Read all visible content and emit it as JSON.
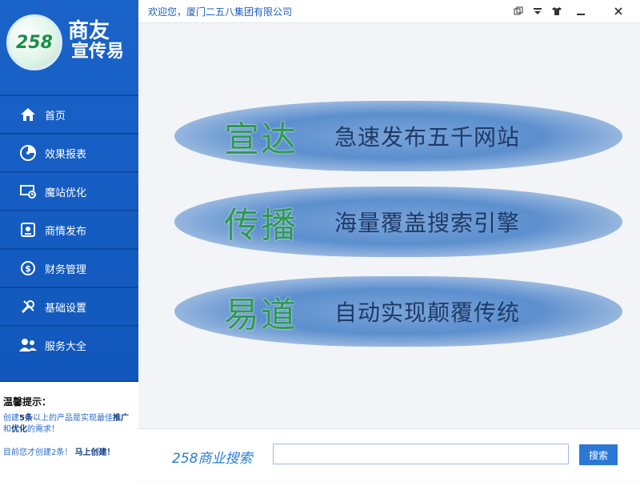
{
  "logo": {
    "number": "258",
    "title": "商友",
    "subtitle": "宣传易"
  },
  "titlebar": {
    "welcome": "欢迎您，厦门二五八集团有限公司",
    "buttons": [
      "restore-icon",
      "dropdown-icon",
      "skin-icon",
      "minimize-icon",
      "close-icon"
    ]
  },
  "sidebar": {
    "items": [
      {
        "label": "首页",
        "icon": "home-icon"
      },
      {
        "label": "效果报表",
        "icon": "report-icon"
      },
      {
        "label": "魔站优化",
        "icon": "optimize-icon"
      },
      {
        "label": "商情发布",
        "icon": "publish-icon"
      },
      {
        "label": "财务管理",
        "icon": "finance-icon"
      },
      {
        "label": "基础设置",
        "icon": "settings-icon"
      },
      {
        "label": "服务大全",
        "icon": "services-icon"
      }
    ]
  },
  "tips": {
    "title": "温馨提示：",
    "body_part1": "创建",
    "body_count": "5条",
    "body_part2": "以上的产品是实现最佳",
    "body_kw1": "推广",
    "body_and": "和",
    "body_kw2": "优化",
    "body_part3": "的需求！",
    "line2_text": "目前您才创建2条！",
    "line2_cta": "马上创建！"
  },
  "banners": [
    {
      "big": "宣达",
      "small": "急速发布五千网站"
    },
    {
      "big": "传播",
      "small": "海量覆盖搜索引擎"
    },
    {
      "big": "易道",
      "small": "自动实现颠覆传统"
    }
  ],
  "search": {
    "brand": "258商业搜索",
    "placeholder": "",
    "value": "",
    "button": "搜索"
  }
}
